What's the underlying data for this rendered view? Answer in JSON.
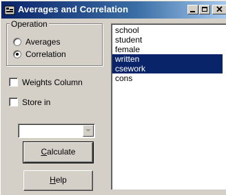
{
  "window": {
    "title": "Averages and Correlation",
    "icon": "stata-app-icon",
    "controls": [
      "minimize-icon",
      "maximize-icon",
      "close-icon"
    ],
    "close_glyph": "✕"
  },
  "operation": {
    "label": "Operation",
    "options": [
      {
        "label": "Averages",
        "checked": false
      },
      {
        "label": "Correlation",
        "checked": true
      }
    ]
  },
  "weights_column": {
    "label": "Weights Column",
    "checked": false
  },
  "store_in": {
    "label": "Store in",
    "checked": false
  },
  "store_combo": {
    "value": "",
    "enabled": false
  },
  "buttons": {
    "calculate": {
      "mnemonic": "C",
      "rest": "alculate"
    },
    "help": {
      "mnemonic": "H",
      "rest": "elp"
    }
  },
  "variables": [
    {
      "name": "school",
      "selected": false
    },
    {
      "name": "student",
      "selected": false
    },
    {
      "name": "female",
      "selected": false
    },
    {
      "name": "written",
      "selected": true
    },
    {
      "name": "csework",
      "selected": true
    },
    {
      "name": "cons",
      "selected": false
    }
  ],
  "colors": {
    "title_bar": "#0a246a",
    "selection": "#0a246a",
    "face": "#d4d0c8"
  }
}
